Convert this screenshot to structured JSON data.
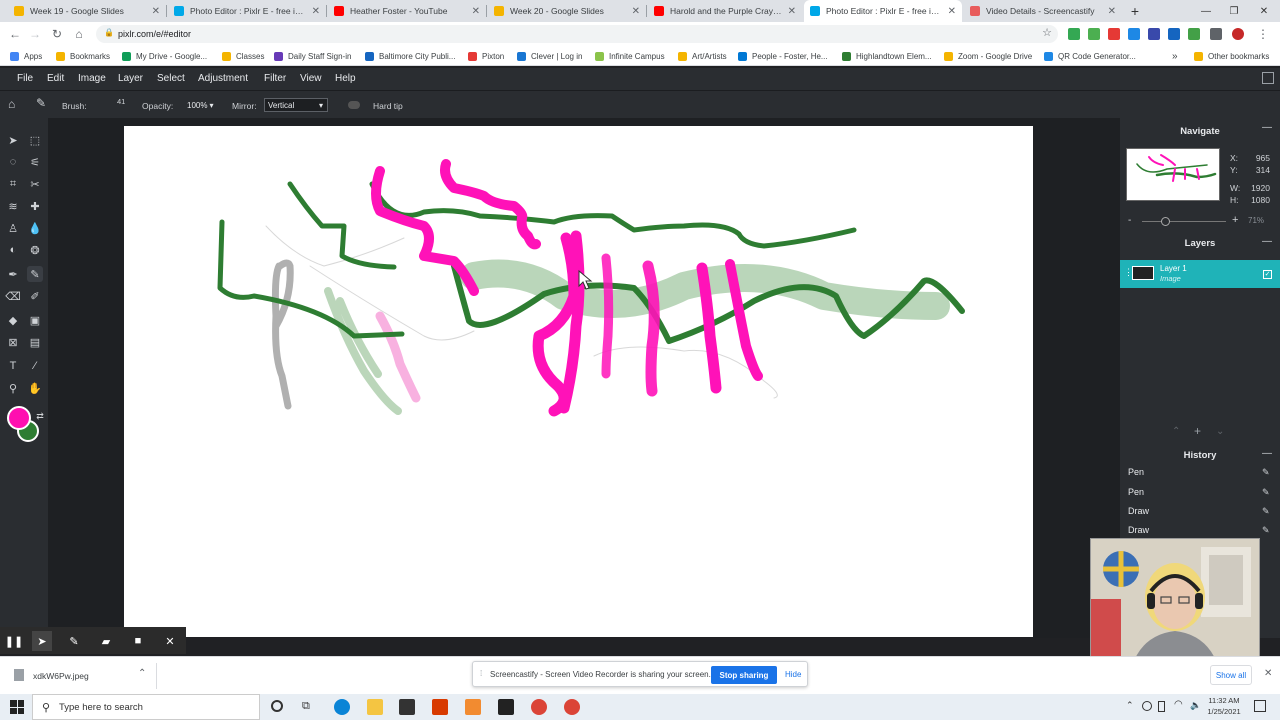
{
  "browser": {
    "tabs": [
      {
        "title": "Week 19 - Google Slides",
        "favicon_color": "#f4b400"
      },
      {
        "title": "Photo Editor : Pixlr E - free image ...",
        "favicon_color": "#00a8e8"
      },
      {
        "title": "Heather Foster - YouTube",
        "favicon_color": "#ff0000"
      },
      {
        "title": "Week 20 - Google Slides",
        "favicon_color": "#f4b400"
      },
      {
        "title": "Harold and the Purple Crayon by ...",
        "favicon_color": "#ff0000"
      },
      {
        "title": "Photo Editor : Pixlr E - free image ...",
        "favicon_color": "#00a8e8"
      },
      {
        "title": "Video Details - Screencastify",
        "favicon_color": "#e85c5c"
      }
    ],
    "active_tab_index": 5,
    "url": "pixlr.com/e/#editor",
    "bookmarks": [
      {
        "label": "Apps",
        "color": "#4285f4"
      },
      {
        "label": "Bookmarks",
        "color": "#f4b400"
      },
      {
        "label": "My Drive - Google...",
        "color": "#0f9d58"
      },
      {
        "label": "Classes",
        "color": "#f4b400"
      },
      {
        "label": "Daily Staff Sign-in",
        "color": "#673ab7"
      },
      {
        "label": "Baltimore City Publi...",
        "color": "#1565c0"
      },
      {
        "label": "Pixton",
        "color": "#e53935"
      },
      {
        "label": "Clever | Log in",
        "color": "#1976d2"
      },
      {
        "label": "Infinite Campus",
        "color": "#8bc34a"
      },
      {
        "label": "Art/Artists",
        "color": "#f4b400"
      },
      {
        "label": "People - Foster, He...",
        "color": "#0078d4"
      },
      {
        "label": "Highlandtown Elem...",
        "color": "#2e7d32"
      },
      {
        "label": "Zoom - Google Drive",
        "color": "#f4b400"
      },
      {
        "label": "QR Code Generator...",
        "color": "#1e88e5"
      },
      {
        "label": "Other bookmarks",
        "color": "#f4b400"
      }
    ],
    "overflow_chevron": "»"
  },
  "pixlr": {
    "menu": [
      "File",
      "Edit",
      "Image",
      "Layer",
      "Select",
      "Adjustment",
      "Filter",
      "View",
      "Help"
    ],
    "options": {
      "brush_label": "Brush:",
      "brush_size": "41",
      "opacity_label": "Opacity:",
      "opacity_value": "100%",
      "mirror_label": "Mirror:",
      "mirror_value": "Vertical",
      "hard_tip_label": "Hard tip"
    },
    "colors": {
      "primary": "#ff0fb0",
      "secondary": "#2e7d32",
      "stroke_green": "#2e7d32",
      "stroke_pink": "#ff12b8"
    },
    "navigate": {
      "title": "Navigate",
      "x_label": "X:",
      "x": "965",
      "y_label": "Y:",
      "y": "314",
      "w_label": "W:",
      "w": "1920",
      "h_label": "H:",
      "h": "1080",
      "zoom": "71%",
      "minus": "-",
      "plus": "+"
    },
    "layers": {
      "title": "Layers",
      "items": [
        {
          "name": "Layer 1",
          "type": "Image"
        }
      ]
    },
    "history": {
      "title": "History",
      "items": [
        "Pen",
        "Pen",
        "Draw",
        "Draw"
      ]
    }
  },
  "screencastify": {
    "banner_text": "Screencastify - Screen Video Recorder is sharing your screen.",
    "stop_label": "Stop sharing",
    "hide_label": "Hide"
  },
  "downloads": {
    "file": "xdkW6Pw.jpeg",
    "show_all": "Show all"
  },
  "taskbar": {
    "search_placeholder": "Type here to search",
    "time": "11:32 AM",
    "date": "1/25/2021"
  }
}
